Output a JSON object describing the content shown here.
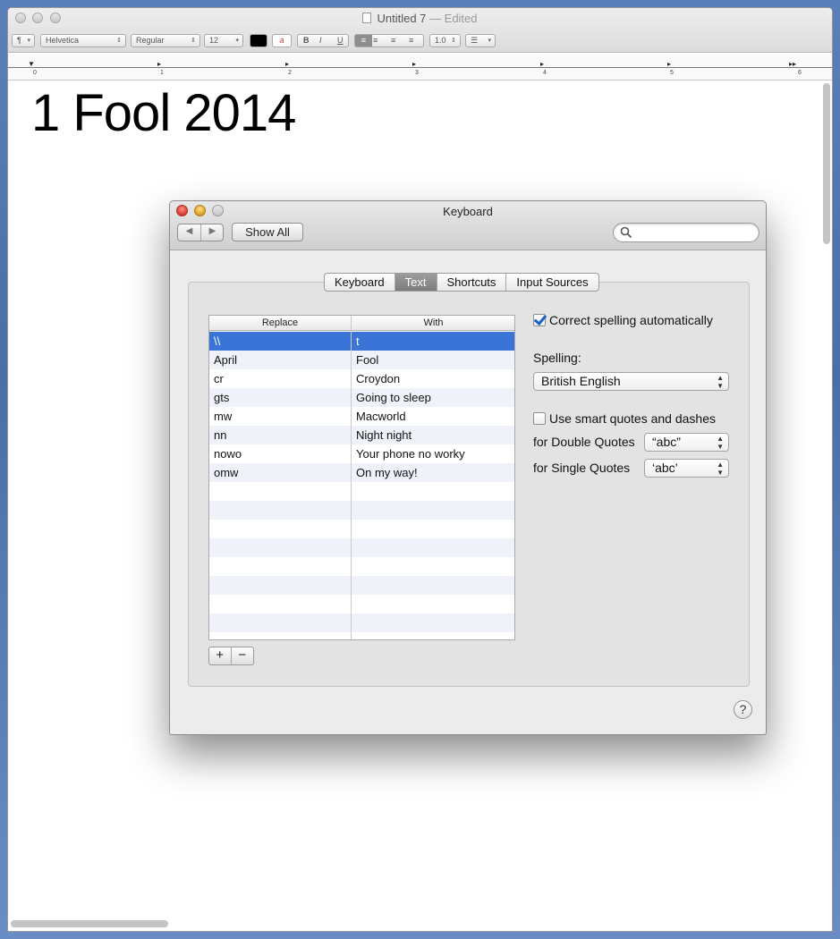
{
  "textedit": {
    "title": "Untitled 7",
    "edited_suffix": "— Edited",
    "toolbar": {
      "paragraph_style": "¶",
      "font_family": "Helvetica",
      "font_style": "Regular",
      "font_size": "12",
      "bold": "B",
      "italic": "I",
      "underline": "U",
      "line_spacing": "1.0",
      "list": "☰"
    },
    "ruler_numbers": [
      "0",
      "1",
      "2",
      "3",
      "4",
      "5",
      "6"
    ],
    "document_text": "1 Fool 2014"
  },
  "keyboard_prefs": {
    "title": "Keyboard",
    "show_all": "Show All",
    "search_placeholder": "",
    "tabs": [
      "Keyboard",
      "Text",
      "Shortcuts",
      "Input Sources"
    ],
    "active_tab": "Text",
    "table": {
      "columns": [
        "Replace",
        "With"
      ],
      "rows": [
        {
          "replace": "\\\\",
          "with": "t"
        },
        {
          "replace": "April",
          "with": "Fool"
        },
        {
          "replace": "cr",
          "with": "Croydon"
        },
        {
          "replace": "gts",
          "with": "Going to sleep"
        },
        {
          "replace": "mw",
          "with": "Macworld"
        },
        {
          "replace": "nn",
          "with": "Night night"
        },
        {
          "replace": "nowo",
          "with": "Your phone no worky"
        },
        {
          "replace": "omw",
          "with": "On my way!"
        }
      ],
      "selected_row": 0
    },
    "add_label": "+",
    "remove_label": "−",
    "correct_spelling": {
      "label": "Correct spelling automatically",
      "checked": true
    },
    "spelling_label": "Spelling:",
    "spelling_value": "British English",
    "smart_quotes": {
      "label": "Use smart quotes and dashes",
      "checked": false
    },
    "double_quotes_label": "for Double Quotes",
    "double_quotes_value": "“abc”",
    "single_quotes_label": "for Single Quotes",
    "single_quotes_value": "‘abc’",
    "help_label": "?"
  },
  "colors": {
    "selection": "#3a74d6",
    "checkbox_check": "#1d5fc9",
    "close_button": "#e0443b",
    "minimize_button": "#e5a82c"
  }
}
